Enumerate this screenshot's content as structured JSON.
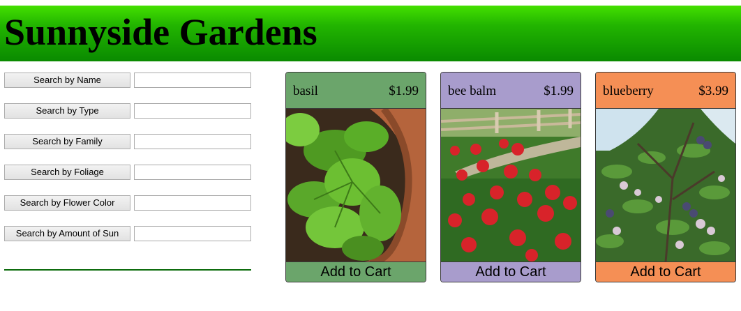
{
  "header": {
    "title": "Sunnyside Gardens"
  },
  "search": {
    "buttons": [
      {
        "label": "Search by Name",
        "value": ""
      },
      {
        "label": "Search by Type",
        "value": ""
      },
      {
        "label": "Search by Family",
        "value": ""
      },
      {
        "label": "Search by Foliage",
        "value": ""
      },
      {
        "label": "Search by Flower Color",
        "value": ""
      },
      {
        "label": "Search by Amount of Sun",
        "value": ""
      }
    ]
  },
  "products": [
    {
      "name": "basil",
      "price": "$1.99",
      "color": "#6ba56b",
      "image": "basil-photo",
      "cart_label": "Add to Cart"
    },
    {
      "name": "bee balm",
      "price": "$1.99",
      "color": "#a89ccc",
      "image": "bee-balm-photo",
      "cart_label": "Add to Cart"
    },
    {
      "name": "blueberry",
      "price": "$3.99",
      "color": "#f58f55",
      "image": "blueberry-photo",
      "cart_label": "Add to Cart"
    }
  ]
}
